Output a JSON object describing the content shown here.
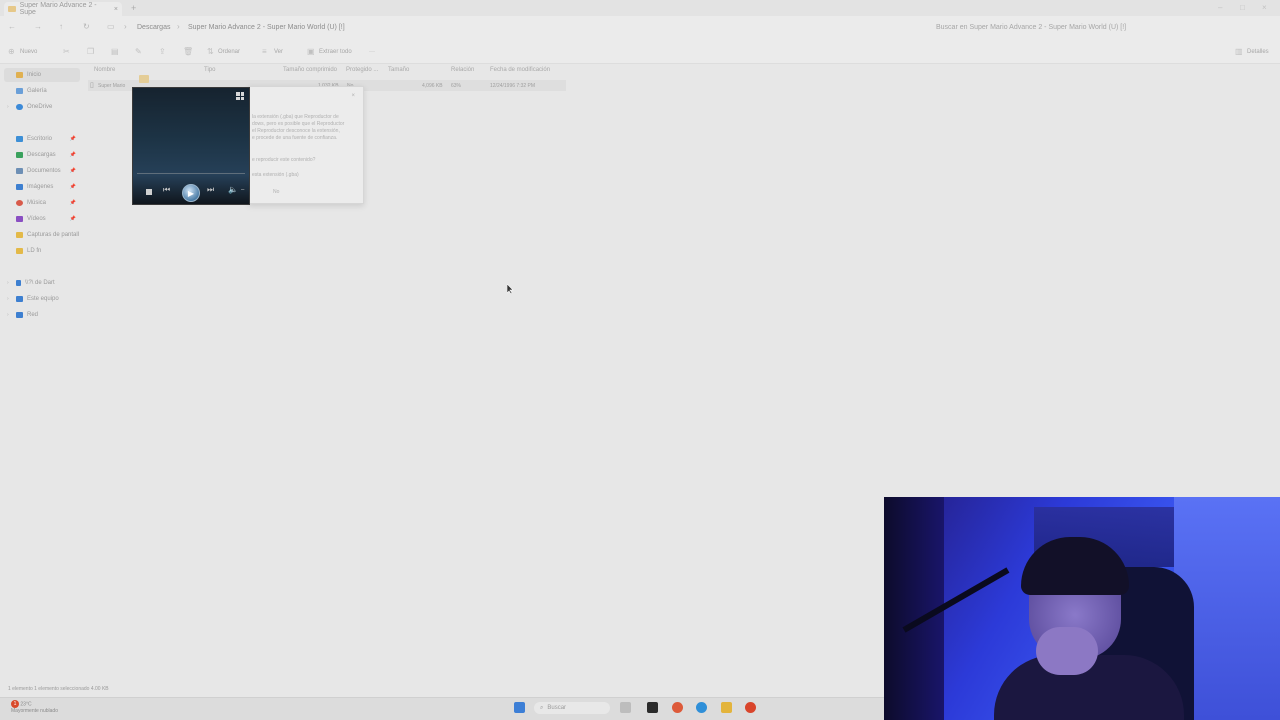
{
  "window": {
    "tab_title": "Super Mario Advance 2 - Supe",
    "tab_close": "×",
    "new_tab": "+",
    "controls": [
      "–",
      "□",
      "×"
    ]
  },
  "address": {
    "nav_icons": [
      "back-icon",
      "forward-icon",
      "up-icon",
      "refresh-icon"
    ],
    "breadcrumb": [
      "Descargas",
      "Super Mario Advance 2 - Super Mario World (U) [!]"
    ],
    "search_placeholder": "Buscar en Super Mario Advance 2 - Super Mario World (U) [!]"
  },
  "toolbar": {
    "new_label": "Nuevo",
    "sort_label": "Ordenar",
    "view_label": "Ver",
    "extract_label": "Extraer todo",
    "more_label": "···",
    "details_label": "Detalles"
  },
  "sidebar": {
    "items": [
      {
        "label": "Inicio",
        "color": "#e0b050"
      },
      {
        "label": "Galería",
        "color": "#6a9fd8"
      },
      {
        "label": "OneDrive",
        "color": "#3c8ad8"
      },
      {
        "label": "Escritorio",
        "color": "#3d8fd6"
      },
      {
        "label": "Descargas",
        "color": "#3aa15d"
      },
      {
        "label": "Documentos",
        "color": "#6d8fb5"
      },
      {
        "label": "Imágenes",
        "color": "#3d7fd0"
      },
      {
        "label": "Música",
        "color": "#d85a4a"
      },
      {
        "label": "Vídeos",
        "color": "#8a4fc2"
      },
      {
        "label": "Capturas de pantall",
        "color": "#e3b948"
      },
      {
        "label": "LD fn",
        "color": "#e3b948"
      },
      {
        "label": "\\\\?\\ de Dart",
        "color": "#3d7fd0"
      },
      {
        "label": "Este equipo",
        "color": "#3d7fd0"
      },
      {
        "label": "Red",
        "color": "#3d7fd0"
      }
    ]
  },
  "columns": [
    "Nombre",
    "Tipo",
    "Tamaño comprimido",
    "Protegido ...",
    "Tamaño",
    "Relación",
    "Fecha de modificación"
  ],
  "file": {
    "name": "Super Mario",
    "compressed": "1,032 KB",
    "protected": "No",
    "size": "4,096 KB",
    "ratio": "63%",
    "modified": "12/24/1996 7:32 PM"
  },
  "dialog": {
    "lines": [
      "la extensión (.gba) que Reproductor de",
      "dows, pero es posible que el Reproductor",
      "el Reproductor desconoce la extensión,",
      "e procede de una fuente de confianza.",
      "e reproducir este contenido?",
      "esta extensión (.gba)",
      "No"
    ]
  },
  "statusbar": {
    "text": "1 elemento    1 elemento seleccionado  4.00 KB"
  },
  "taskbar": {
    "weather_temp": "23°C",
    "weather_desc": "Mayormente nublado",
    "alert_count": "1",
    "search_label": "Buscar",
    "apps": [
      {
        "name": "windows-start-icon",
        "color": "#3d7fd6"
      },
      {
        "name": "terminal-app-icon",
        "color": "#2b2b2b"
      },
      {
        "name": "chrome-app-icon",
        "color": "#dd5a3a"
      },
      {
        "name": "edge-app-icon",
        "color": "#2f8fd8"
      },
      {
        "name": "file-explorer-app-icon",
        "color": "#e3b43c"
      },
      {
        "name": "red-app-icon",
        "color": "#d9452b"
      }
    ]
  }
}
